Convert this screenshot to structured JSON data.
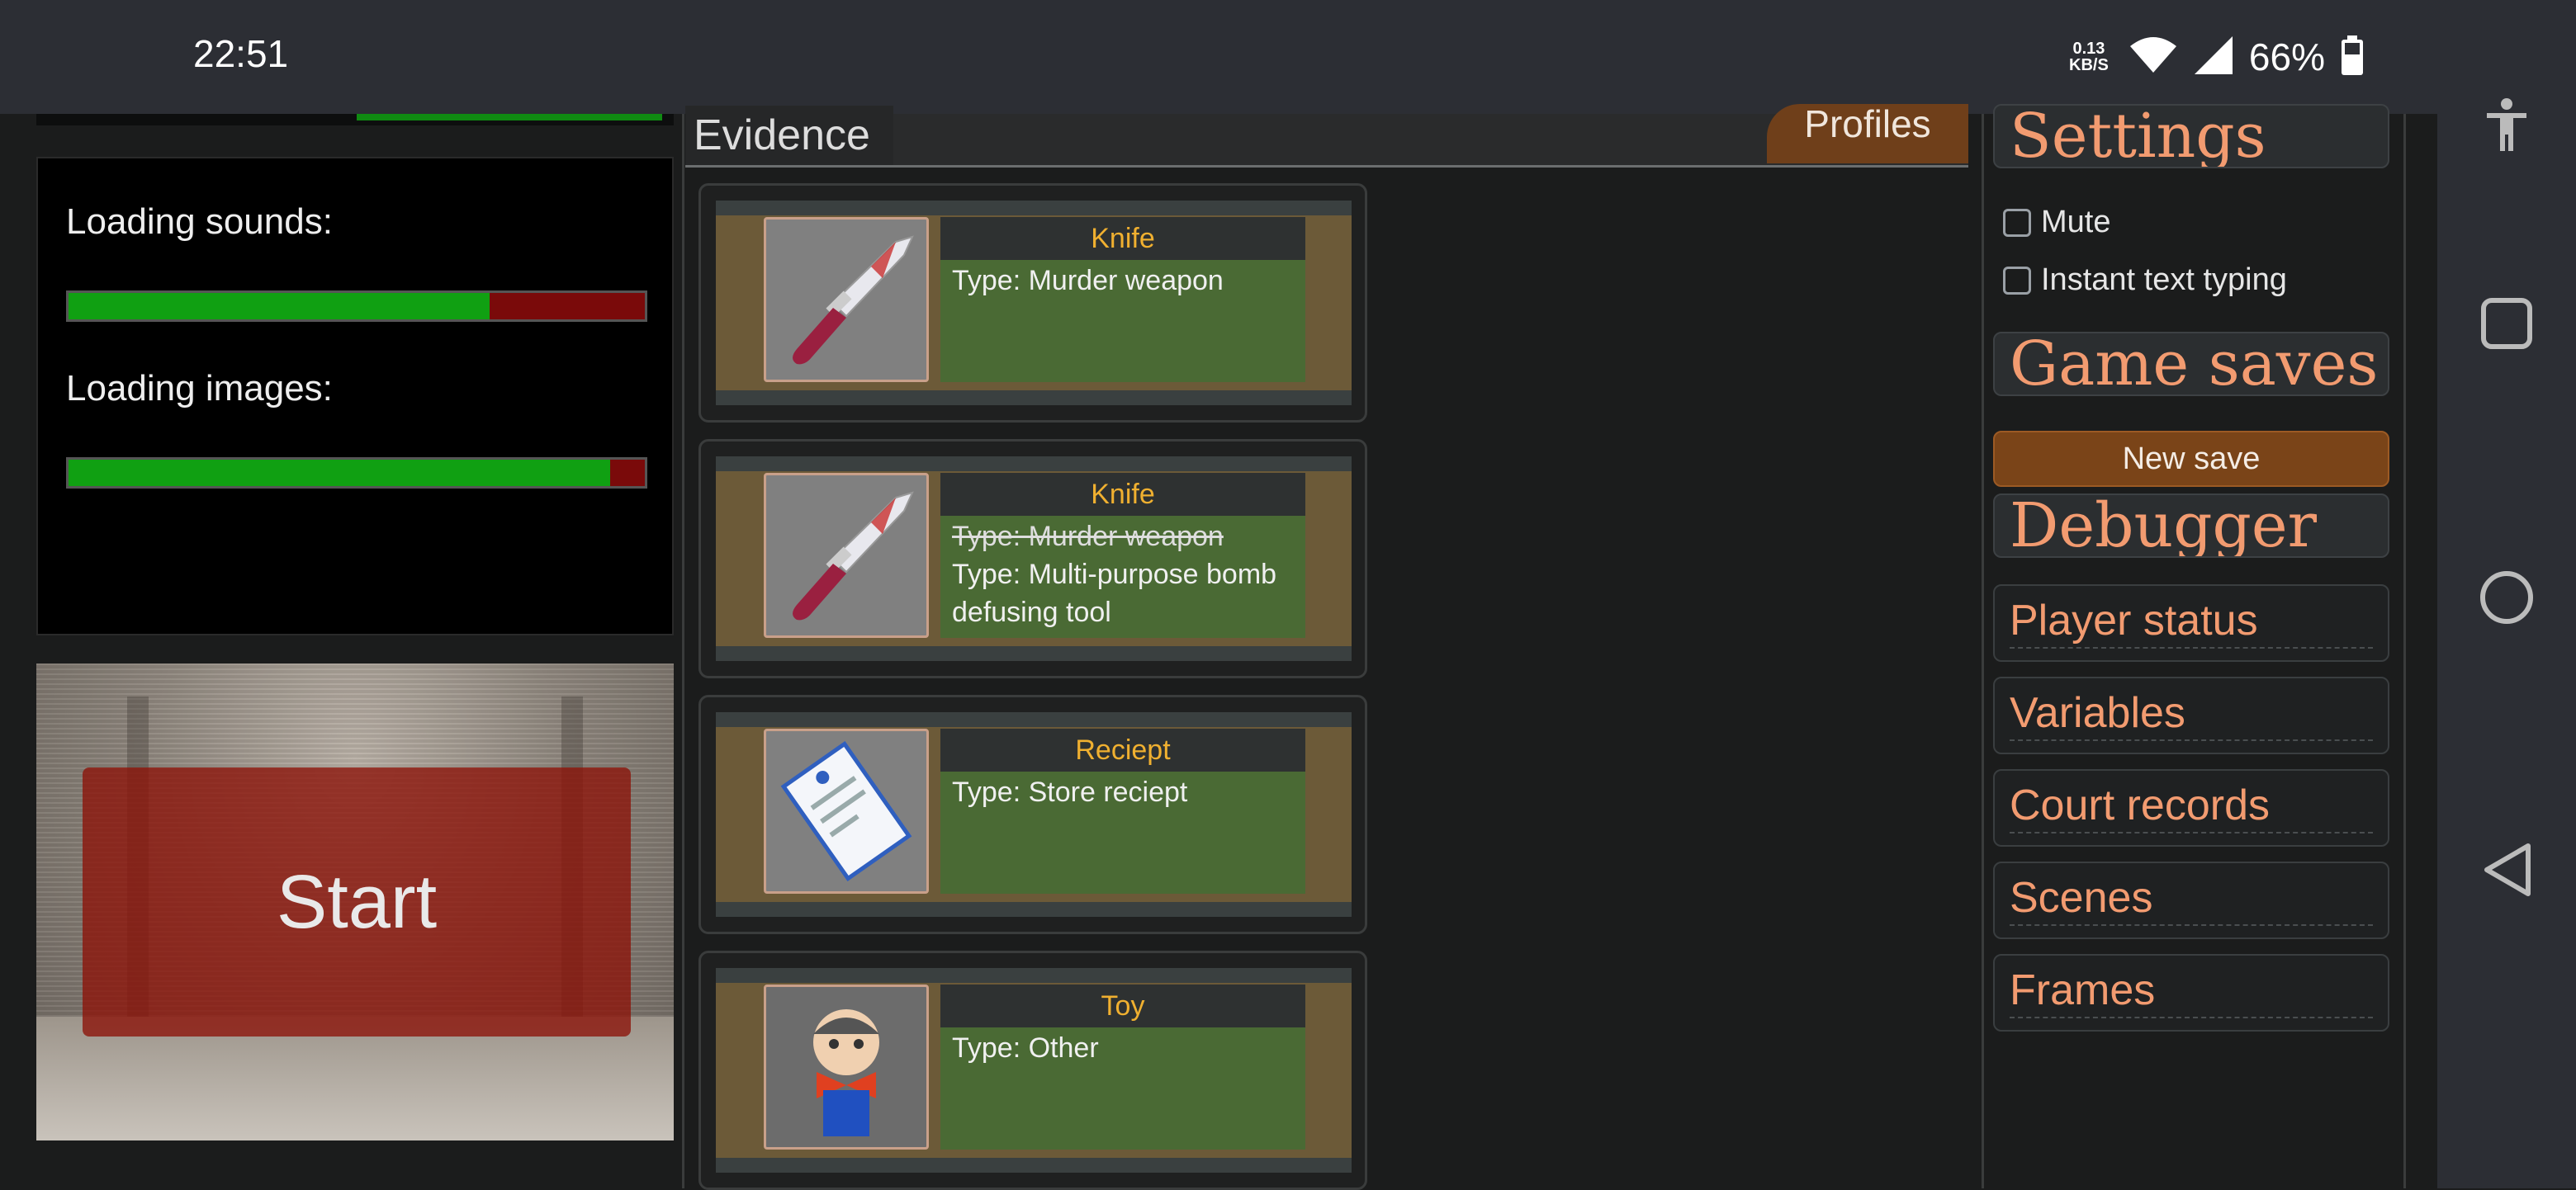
{
  "status_bar": {
    "time": "22:51",
    "net_speed_value": "0.13",
    "net_speed_unit": "KB/S",
    "battery": "66%",
    "icons": [
      "wifi-icon",
      "signal-icon",
      "battery-icon"
    ]
  },
  "nav_bar": {
    "icons": [
      "accessibility-icon",
      "recents-icon",
      "home-icon",
      "back-icon"
    ]
  },
  "loading": {
    "sounds_label": "Loading sounds:",
    "sounds_progress": 0.73,
    "images_label": "Loading images:",
    "images_progress": 0.94
  },
  "start": {
    "label": "Start"
  },
  "evidence": {
    "tab_label": "Evidence",
    "profiles_label": "Profiles",
    "items": [
      {
        "name": "Knife",
        "image": "knife-icon",
        "lines": [
          {
            "text": "Type: Murder weapon",
            "struck": false
          }
        ]
      },
      {
        "name": "Knife",
        "image": "knife-icon",
        "lines": [
          {
            "text": "Type: Murder weapon",
            "struck": true
          },
          {
            "text": "Type: Multi-purpose bomb defusing tool",
            "struck": false
          }
        ]
      },
      {
        "name": "Reciept",
        "image": "receipt-icon",
        "lines": [
          {
            "text": "Type: Store reciept",
            "struck": false
          }
        ]
      },
      {
        "name": "Toy",
        "image": "toy-icon",
        "lines": [
          {
            "text": "Type: Other",
            "struck": false
          }
        ]
      }
    ]
  },
  "settings": {
    "heading": "Settings",
    "mute_label": "Mute",
    "instant_label": "Instant text typing"
  },
  "game_saves": {
    "heading": "Game saves",
    "new_save_label": "New save"
  },
  "debugger": {
    "heading": "Debugger",
    "items": [
      "Player status",
      "Variables",
      "Court records",
      "Scenes",
      "Frames"
    ]
  },
  "colors": {
    "accent": "#f29b70",
    "evidence_name": "#f0b030",
    "progress_fill": "#10a012",
    "progress_empty": "#7a0a0a"
  }
}
